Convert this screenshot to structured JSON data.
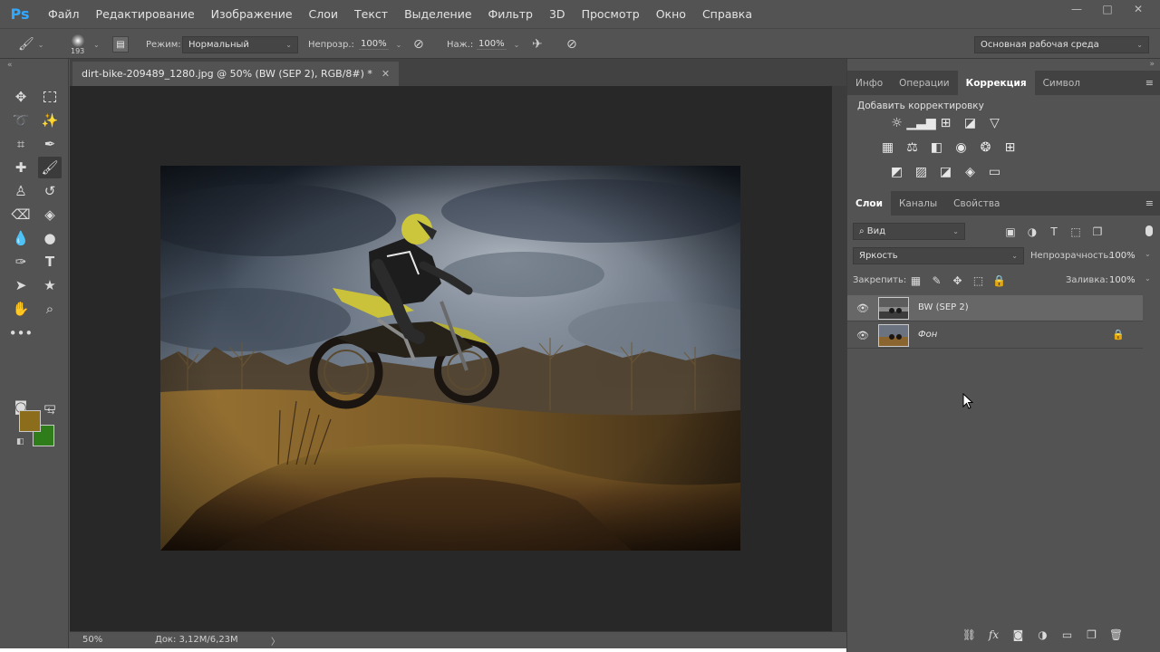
{
  "app": {
    "logo": "Ps"
  },
  "menu": [
    "Файл",
    "Редактирование",
    "Изображение",
    "Слои",
    "Текст",
    "Выделение",
    "Фильтр",
    "3D",
    "Просмотр",
    "Окно",
    "Справка"
  ],
  "window_controls": {
    "minimize": "—",
    "maximize": "□",
    "close": "✕"
  },
  "options_bar": {
    "brush_size": "193",
    "mode_label": "Режим:",
    "mode_value": "Нормальный",
    "opacity_label": "Непрозр.:",
    "opacity_value": "100%",
    "pressure_label": "Наж.:",
    "pressure_value": "100%",
    "workspace": "Основная рабочая среда"
  },
  "document": {
    "tab_title": "dirt-bike-209489_1280.jpg @ 50% (BW (SEP 2), RGB/8#) *",
    "close": "✕"
  },
  "colors": {
    "foreground": "#8b6d1c",
    "background": "#2e7d1a"
  },
  "status_bar": {
    "zoom": "50%",
    "doc_info": "Док: 3,12M/6,23M",
    "arrow": "〉"
  },
  "top_panel": {
    "tabs": [
      "Инфо",
      "Операции",
      "Коррекция",
      "Символ"
    ],
    "active_tab": "Коррекция",
    "title": "Добавить корректировку"
  },
  "layers_panel": {
    "tabs": [
      "Слои",
      "Каналы",
      "Свойства"
    ],
    "active_tab": "Слои",
    "filter_value": "Вид",
    "blend_mode": "Яркость",
    "opacity_label": "Непрозрачность:",
    "opacity_value": "100%",
    "lock_label": "Закрепить:",
    "fill_label": "Заливка:",
    "fill_value": "100%",
    "layers": [
      {
        "name": "BW (SEP 2)",
        "selected": true
      },
      {
        "name": "Фон",
        "selected": false,
        "locked": true
      }
    ]
  }
}
